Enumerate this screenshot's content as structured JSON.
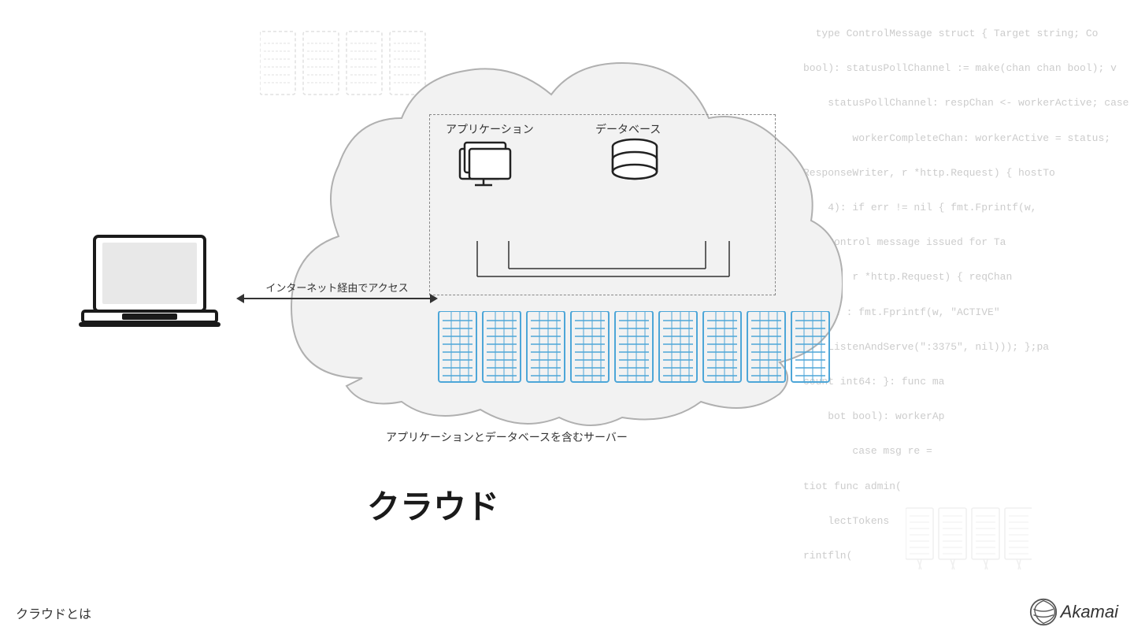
{
  "code_lines": [
    "type ControlMessage struct { Target string; Co",
    "bool): statusPollChannel := make(chan chan bool); v",
    "statusPollChannel: respChan <- workerActive; case",
    "workerCompleteChan: workerActive = status;",
    "ResponseWriter, r *http.Request) { hostTo",
    "4): if err != nil { fmt.Fprintf(w,",
    "Control message issued for Ta",
    "r *http.Request) { reqChan",
    "result : fmt.Fprintf(w, \"ACTIVE\"",
    "ListenAndServe(\":3375\", nil))); }; pa",
    "count int64: }: func ma",
    "bot bool): workerAp",
    "case msg re =",
    "tiot func admin(",
    "lectTokens",
    "rintfln("
  ],
  "labels": {
    "app": "アプリケーション",
    "db": "データベース",
    "arrow": "インターネット経由でアクセス",
    "server_caption": "アプリケーションとデータベースを含むサーバー",
    "cloud": "クラウド",
    "bottom_left": "クラウドとは",
    "akamai": "Akamai"
  },
  "colors": {
    "server_blue": "#4da6d8",
    "cloud_outline": "#b0b0b0",
    "cloud_fill": "#f0f0f0",
    "dashed_box": "#888888",
    "text_dark": "#1a1a1a",
    "text_medium": "#333333",
    "code_text": "#cccccc"
  }
}
